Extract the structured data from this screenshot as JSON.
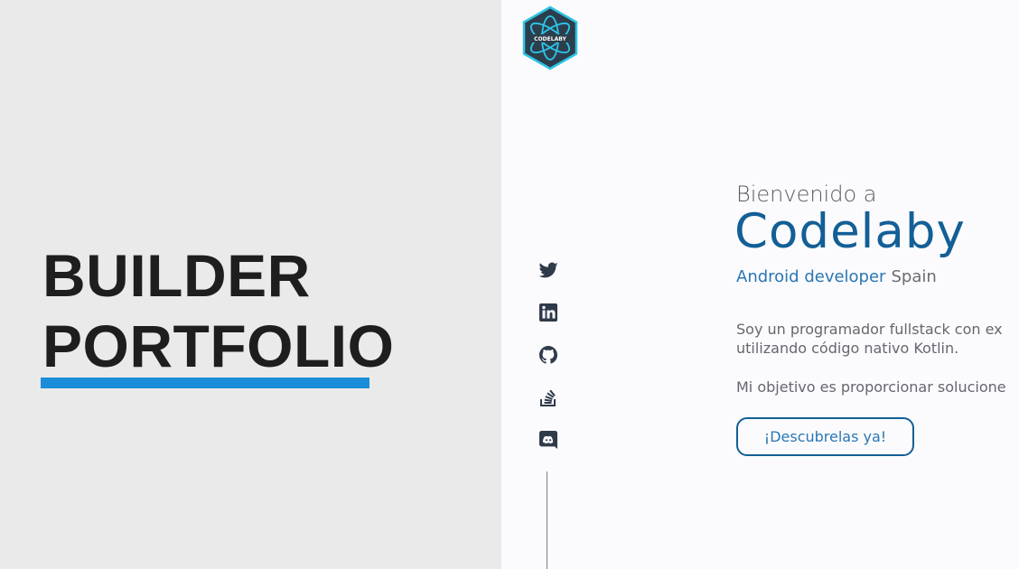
{
  "banner": {
    "title_line1": "BUILDER",
    "title_line2": "PORTFOLIO",
    "accent_color": "#1a8cd8"
  },
  "site": {
    "logo_text": "CODELABY",
    "social_icons": [
      "twitter-icon",
      "linkedin-icon",
      "github-icon",
      "stackoverflow-icon",
      "discord-icon"
    ],
    "welcome": "Bienvenido a",
    "brand_name": "Codelaby",
    "role": "Android developer",
    "location": "Spain",
    "description_line1": "Soy un programador fullstack con ex",
    "description_line2": "utilizando código nativo Kotlin.",
    "goal": "Mi objetivo es proporcionar solucione",
    "cta_label": "¡Descubrelas ya!",
    "brand_color": "#135f96"
  }
}
